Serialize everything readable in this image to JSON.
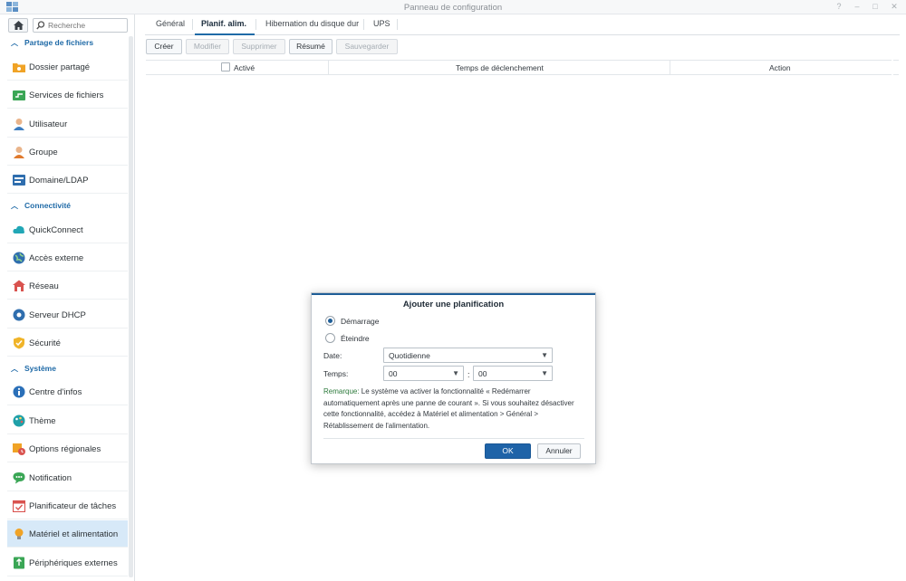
{
  "window": {
    "title": "Panneau de configuration",
    "controls": [
      "?",
      "–",
      "□",
      "✕"
    ]
  },
  "search": {
    "placeholder": "Recherche"
  },
  "sidebar": {
    "sections": [
      {
        "label": "Partage de fichiers",
        "items": [
          {
            "label": "Dossier partagé",
            "icon": "shared-folder-icon"
          },
          {
            "label": "Services de fichiers",
            "icon": "file-services-icon"
          },
          {
            "label": "Utilisateur",
            "icon": "user-icon"
          },
          {
            "label": "Groupe",
            "icon": "group-icon"
          },
          {
            "label": "Domaine/LDAP",
            "icon": "domain-ldap-icon"
          }
        ]
      },
      {
        "label": "Connectivité",
        "items": [
          {
            "label": "QuickConnect",
            "icon": "quickconnect-icon"
          },
          {
            "label": "Accès externe",
            "icon": "external-access-icon"
          },
          {
            "label": "Réseau",
            "icon": "network-icon"
          },
          {
            "label": "Serveur DHCP",
            "icon": "dhcp-server-icon"
          },
          {
            "label": "Sécurité",
            "icon": "security-icon"
          }
        ]
      },
      {
        "label": "Système",
        "items": [
          {
            "label": "Centre d'infos",
            "icon": "info-center-icon"
          },
          {
            "label": "Thème",
            "icon": "theme-icon"
          },
          {
            "label": "Options régionales",
            "icon": "regional-options-icon"
          },
          {
            "label": "Notification",
            "icon": "notification-icon"
          },
          {
            "label": "Planificateur de tâches",
            "icon": "task-scheduler-icon"
          },
          {
            "label": "Matériel et alimentation",
            "icon": "hardware-power-icon",
            "selected": true
          },
          {
            "label": "Périphériques externes",
            "icon": "external-devices-icon"
          }
        ]
      }
    ]
  },
  "tabs": [
    "Général",
    "Planif. alim.",
    "Hibernation du disque dur",
    "UPS"
  ],
  "active_tab": "Planif. alim.",
  "toolbar": {
    "create": "Créer",
    "edit": "Modifier",
    "delete": "Supprimer",
    "summary": "Résumé",
    "save": "Sauvegarder"
  },
  "table": {
    "columns": [
      "Activé",
      "Temps de déclenchement",
      "Action"
    ]
  },
  "dialog": {
    "title": "Ajouter une planification",
    "radio_startup": "Démarrage",
    "radio_shutdown": "Éteindre",
    "selected_radio": "Démarrage",
    "date_label": "Date:",
    "date_value": "Quotidienne",
    "time_label": "Temps:",
    "hour_value": "00",
    "minute_value": "00",
    "time_separator": ":",
    "note_prefix": "Remarque:",
    "note_text": " Le système va activer la fonctionnalité « Redémarrer automatiquement après une panne de courant ». Si vous souhaitez désactiver cette fonctionnalité, accédez à Matériel et alimentation > Général > Rétablissement de l'alimentation.",
    "ok": "OK",
    "cancel": "Annuler"
  },
  "colors": {
    "accent": "#1f6aa7",
    "selected_bg": "#d7e9f8",
    "ok_button": "#1e63a8",
    "note_highlight": "#2d7a3c"
  }
}
